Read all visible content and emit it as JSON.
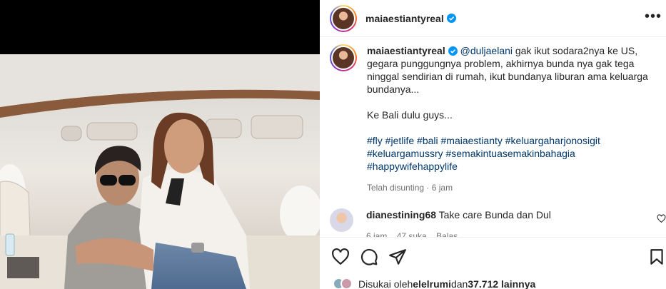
{
  "post": {
    "username": "maiaestiantyreal"
  },
  "caption": {
    "username": "maiaestiantyreal",
    "mention": "@duljaelani",
    "text": " gak ikut sodara2nya ke US, gegara punggungnya problem, akhirnya bunda nya gak tega ninggal sendirian di rumah, ikut bundanya liburan ama keluarga bundanya...\n\nKe Bali dulu guys...\n\n",
    "hashtags": "#fly #jetlife #bali #maiaestianty #keluargaharjonosigit #keluargamussry #semakintuasemakinbahagia #happywifehappylife",
    "edited": "Telah disunting · 6 jam"
  },
  "comment": {
    "username": "dianestining68",
    "text": "Take care Bunda dan Dul",
    "time": "6 jam",
    "likes": "47 suka",
    "reply": "Balas"
  },
  "likes": {
    "prefix": "Disukai oleh ",
    "user": "elelrumi",
    "middle": " dan ",
    "count": "37.712 lainnya"
  },
  "icons": {
    "more": "more-options-icon",
    "like": "heart-icon",
    "comment": "comment-icon",
    "share": "share-icon",
    "save": "bookmark-icon",
    "verified": "verified-badge-icon"
  },
  "colors": {
    "link": "#00376b",
    "verified": "#0095f6",
    "muted": "#737373"
  }
}
